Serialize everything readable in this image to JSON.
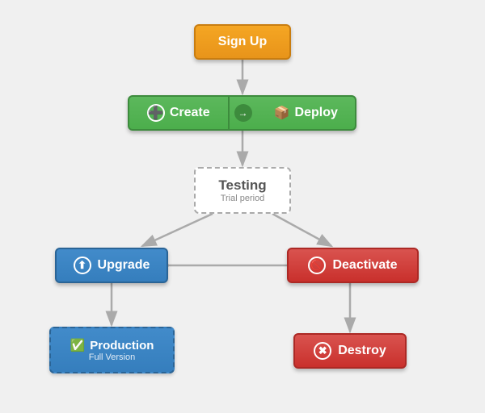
{
  "nodes": {
    "signup": {
      "label": "Sign Up"
    },
    "create_deploy": {
      "create_label": "Create",
      "deploy_label": "Deploy"
    },
    "testing": {
      "label": "Testing",
      "subtitle": "Trial period"
    },
    "upgrade": {
      "label": "Upgrade"
    },
    "deactivate": {
      "label": "Deactivate"
    },
    "production": {
      "label": "Production",
      "subtitle": "Full Version"
    },
    "destroy": {
      "label": "Destroy"
    }
  }
}
